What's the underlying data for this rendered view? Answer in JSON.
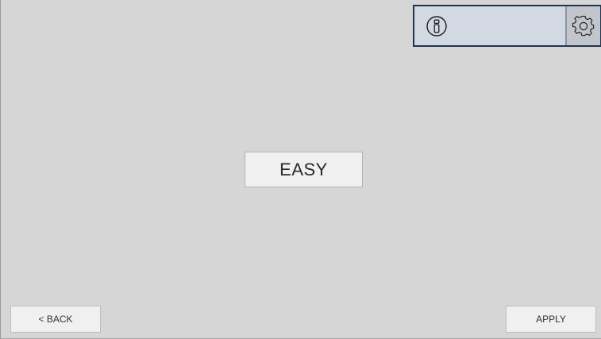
{
  "header": {
    "info_icon": "info-icon",
    "settings_icon": "gear-icon"
  },
  "main": {
    "difficulty_label": "EASY"
  },
  "footer": {
    "back_label": "< BACK",
    "apply_label": "APPLY"
  },
  "colors": {
    "background": "#d6d6d6",
    "panel_border": "#22344f",
    "panel_fill": "#d3d9e2",
    "button_fill": "#f0f0f0"
  }
}
